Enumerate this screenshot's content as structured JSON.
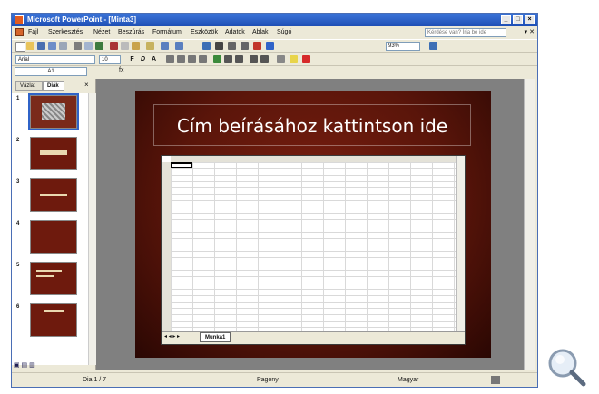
{
  "window": {
    "title": "Microsoft PowerPoint - [Minta3]"
  },
  "menu": {
    "items": [
      "Fájl",
      "Szerkesztés",
      "Nézet",
      "Beszúrás",
      "Formátum",
      "Eszközök",
      "Adatok",
      "Ablak",
      "Súgó"
    ],
    "ask_placeholder": "Kérdése van? Írja be ide"
  },
  "toolbar": {
    "zoom": "93%",
    "font_name": "Arial",
    "font_size": "10"
  },
  "formula_bar": {
    "name_box": "A1",
    "fx": "fx"
  },
  "pane": {
    "tab_outline": "Vázlat",
    "tab_slides": "Diák",
    "slide_numbers": [
      "1",
      "2",
      "3",
      "4",
      "5",
      "6"
    ]
  },
  "slide": {
    "title_placeholder": "Cím beírásához kattintson ide"
  },
  "sheet": {
    "tab_label": "Munka1"
  },
  "status": {
    "slide_info": "Dia 1 / 7",
    "design": "Pagony",
    "language": "Magyar"
  }
}
